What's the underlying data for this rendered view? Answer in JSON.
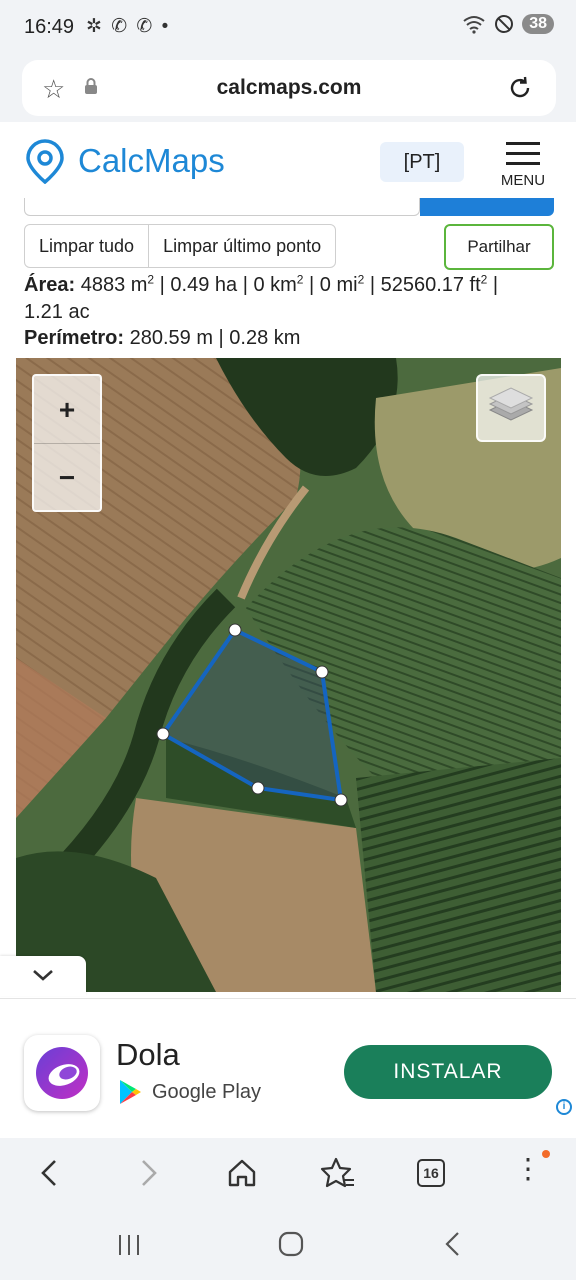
{
  "status_bar": {
    "time": "16:49",
    "left_icons": "✲ ✆ ✆ •",
    "battery": "38"
  },
  "url_bar": {
    "url": "calcmaps.com"
  },
  "header": {
    "logo_text": "CalcMaps",
    "lang_button": "[PT]",
    "menu_label": "MENU"
  },
  "toolbar": {
    "clear_all": "Limpar tudo",
    "clear_last": "Limpar último ponto",
    "share": "Partilhar"
  },
  "measurements": {
    "area_label": "Área:",
    "area_m2": "4883 m",
    "area_rest1": " | 0.49 ha | 0 km",
    "area_rest2": " | 0 mi",
    "area_rest3": " | 52560.17 ft",
    "area_rest4": " |",
    "area_ac": "1.21 ac",
    "sq": "2",
    "perimeter_label": "Perímetro:",
    "perimeter_value": "280.59 m | 0.28 km"
  },
  "map": {
    "zoom_in": "+",
    "zoom_out": "−",
    "polygon_color": "#1565c0",
    "collapse": "⌄"
  },
  "ad": {
    "app_name": "Dola",
    "store": "Google Play",
    "install": "INSTALAR",
    "info": "i"
  },
  "browser_nav": {
    "back": "‹",
    "forward": "›",
    "home": "⌂",
    "bookmarks": "☆",
    "tabs": "16",
    "more": "⋮"
  },
  "system_nav": {
    "recents": "|||",
    "home": "○",
    "back": "‹"
  }
}
